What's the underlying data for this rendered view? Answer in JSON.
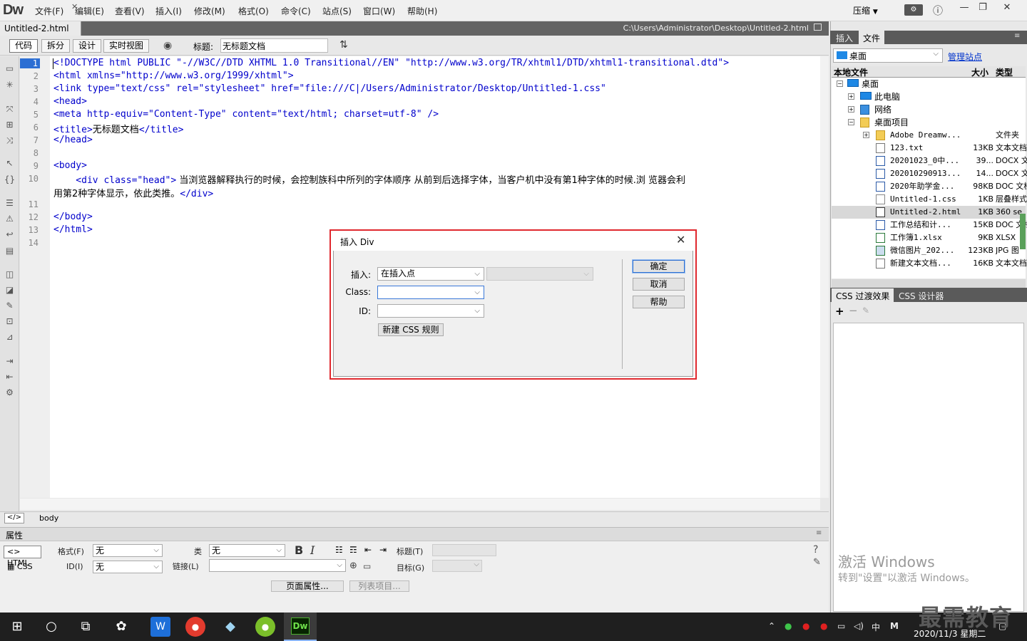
{
  "app": {
    "logo": "Dw",
    "menus": [
      "文件(F)",
      "编辑(E)",
      "查看(V)",
      "插入(I)",
      "修改(M)",
      "格式(O)",
      "命令(C)",
      "站点(S)",
      "窗口(W)",
      "帮助(H)"
    ],
    "workspace": "压缩",
    "window_buttons": [
      "—",
      "❐",
      "✕"
    ]
  },
  "document": {
    "tab": "Untitled-2.html",
    "path": "C:\\Users\\Administrator\\Desktop\\Untitled-2.html"
  },
  "toolbar": {
    "views": [
      "代码",
      "拆分",
      "设计",
      "实时视图"
    ],
    "title_label": "标题:",
    "title_value": "无标题文档"
  },
  "editor": {
    "current_line": 1,
    "line_numbers": [
      "1",
      "2",
      "3",
      "4",
      "5",
      "6",
      "7",
      "8",
      "9",
      "10",
      "",
      "11",
      "12",
      "13",
      "14"
    ],
    "lines": [
      "<!DOCTYPE html PUBLIC \"-//W3C//DTD XHTML 1.0 Transitional//EN\" \"http://www.w3.org/TR/xhtml1/DTD/xhtml1-transitional.dtd\">",
      "<html xmlns=\"http://www.w3.org/1999/xhtml\">",
      "<link type=\"text/css\" rel=\"stylesheet\" href=\"file:///C|/Users/Administrator/Desktop/Untitled-1.css\"",
      "<head>",
      "<meta http-equiv=\"Content-Type\" content=\"text/html; charset=utf-8\" />",
      "<title>",
      "</head>",
      "",
      "<body>",
      "    <div class=\"head\">",
      "用第2种字体显示，依此类推。",
      "",
      "</body>",
      "</html>",
      ""
    ],
    "title_text": "无标题文档",
    "title_close": "</title>",
    "div_text": " 当浏览器解释执行的时候，会控制族科中所列的字体顺序 从前到后选择字体，当客户机中没有第1种字体的时候.浏 览器会利",
    "div_close": "</div>"
  },
  "status": {
    "tag": "body",
    "tag_icon": "</>"
  },
  "properties": {
    "title": "属性",
    "html_btn": "HTML",
    "css_btn": "CSS",
    "format_label": "格式(F)",
    "format_value": "无",
    "class_label": "类",
    "class_value": "无",
    "id_label": "ID(I)",
    "id_value": "无",
    "link_label": "链接(L)",
    "title_label": "标题(T)",
    "target_label": "目标(G)",
    "page_props_btn": "页面属性...",
    "list_item_btn": "列表项目..."
  },
  "files_panel": {
    "tabs": [
      "插入",
      "文件"
    ],
    "site": "桌面",
    "manage": "管理站点",
    "col_local": "本地文件",
    "col_size": "大小",
    "col_type": "类型",
    "tree": [
      {
        "name": "桌面",
        "size": "",
        "type": "",
        "level": 0,
        "icon": "monitor"
      },
      {
        "name": "此电脑",
        "size": "",
        "type": "",
        "level": 1,
        "icon": "monitor"
      },
      {
        "name": "网络",
        "size": "",
        "type": "",
        "level": 1,
        "icon": "network"
      },
      {
        "name": "桌面项目",
        "size": "",
        "type": "",
        "level": 1,
        "icon": "folder"
      },
      {
        "name": "Adobe Dreamw...",
        "size": "",
        "type": "文件夹",
        "level": 2,
        "icon": "folder"
      },
      {
        "name": "123.txt",
        "size": "13KB",
        "type": "文本文档",
        "level": 2,
        "icon": "txt"
      },
      {
        "name": "20201023_0中...",
        "size": "39...",
        "type": "DOCX 文",
        "level": 2,
        "icon": "word"
      },
      {
        "name": "202010290913...",
        "size": "14...",
        "type": "DOCX 文",
        "level": 2,
        "icon": "word"
      },
      {
        "name": "2020年助学金...",
        "size": "98KB",
        "type": "DOC 文档",
        "level": 2,
        "icon": "word"
      },
      {
        "name": "Untitled-1.css",
        "size": "1KB",
        "type": "层叠样式",
        "level": 2,
        "icon": "css"
      },
      {
        "name": "Untitled-2.html",
        "size": "1KB",
        "type": "360 se",
        "level": 2,
        "icon": "html",
        "selected": true
      },
      {
        "name": "工作总结和计...",
        "size": "15KB",
        "type": "DOC 文档",
        "level": 2,
        "icon": "word"
      },
      {
        "name": "工作簿1.xlsx",
        "size": "9KB",
        "type": "XLSX",
        "level": 2,
        "icon": "xlsx"
      },
      {
        "name": "微信图片_202...",
        "size": "123KB",
        "type": "JPG 图",
        "level": 2,
        "icon": "jpg"
      },
      {
        "name": "新建文本文档...",
        "size": "16KB",
        "type": "文本文档",
        "level": 2,
        "icon": "txt"
      }
    ]
  },
  "css_panel": {
    "tabs": [
      "CSS 过渡效果",
      "CSS 设计器"
    ],
    "add": "+",
    "remove": "−"
  },
  "watermark": {
    "line1": "激活 Windows",
    "line2": "转到\"设置\"以激活 Windows。",
    "brand": "最需教育"
  },
  "dialog": {
    "title": "插入 Div",
    "insert_label": "插入:",
    "insert_value": "在插入点",
    "class_label": "Class:",
    "class_value": "",
    "id_label": "ID:",
    "id_value": "",
    "new_css_btn": "新建 CSS 规则",
    "ok": "确定",
    "cancel": "取消",
    "help": "帮助"
  },
  "taskbar": {
    "ime": "中",
    "ime2": "M",
    "date": "2020/11/3 星期二"
  },
  "colors": {
    "accent": "#2d6fd3",
    "dialog_highlight": "#e0282e",
    "code_tag": "#0000cc",
    "link": "#0033cc"
  }
}
